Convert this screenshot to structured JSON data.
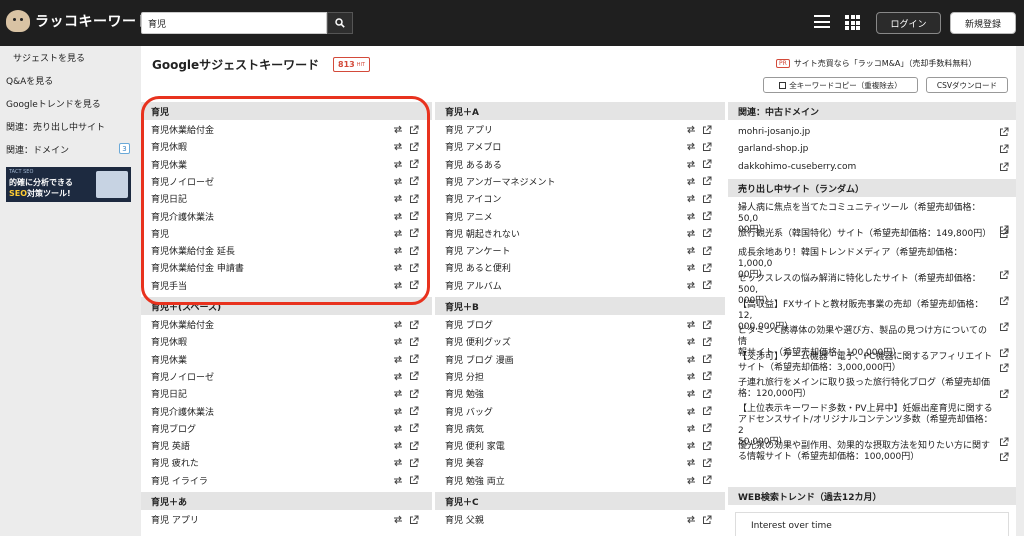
{
  "header": {
    "logo_text": "ラッコキーワード",
    "search_value": "育児",
    "login_label": "ログイン",
    "register_label": "新規登録"
  },
  "sidebar": {
    "items": [
      {
        "label": "サジェストを見る"
      },
      {
        "label": "Q&Aを見る"
      },
      {
        "label": "Googleトレンドを見る"
      },
      {
        "label": "関連：売り出し中サイト"
      },
      {
        "label": "関連：ドメイン",
        "badge": "3"
      }
    ],
    "banner": {
      "top": "TACT SEO",
      "line1": "的確に分析できる",
      "line2_a": "SEO",
      "line2_b": "対策ツール!"
    }
  },
  "main": {
    "title": "Googleサジェストキーワード",
    "hit_count": "813",
    "hit_unit": "HIT",
    "pr_badge": "PR",
    "pr_text": "サイト売買なら「ラッコM&A」（売却手数料無料）",
    "copy_label": "全キーワードコピー（重複除去）",
    "csv_label": "CSVダウンロード"
  },
  "columns": {
    "col1": [
      {
        "title": "育児",
        "items": [
          "育児休業給付金",
          "育児休暇",
          "育児休業",
          "育児ノイローゼ",
          "育児日記",
          "育児介護休業法",
          "育児",
          "育児休業給付金 延長",
          "育児休業給付金 申請書",
          "育児手当"
        ]
      },
      {
        "title": "育児＋(スペース)",
        "items": [
          "育児休業給付金",
          "育児休暇",
          "育児休業",
          "育児ノイローゼ",
          "育児日記",
          "育児介護休業法",
          "育児ブログ",
          "育児 英語",
          "育児 疲れた",
          "育児 イライラ"
        ]
      },
      {
        "title": "育児＋あ",
        "items": [
          "育児 アプリ"
        ]
      }
    ],
    "col2": [
      {
        "title": "育児＋A",
        "items": [
          "育児 アプリ",
          "育児 アメブロ",
          "育児 あるある",
          "育児 アンガーマネジメント",
          "育児 アイコン",
          "育児 アニメ",
          "育児 朝起きれない",
          "育児 アンケート",
          "育児 あると便利",
          "育児 アルバム"
        ]
      },
      {
        "title": "育児＋B",
        "items": [
          "育児 ブログ",
          "育児 便利グッズ",
          "育児 ブログ 漫画",
          "育児 分担",
          "育児 勉強",
          "育児 バッグ",
          "育児 病気",
          "育児 便利 家電",
          "育児 美容",
          "育児 勉強 両立"
        ]
      },
      {
        "title": "育児＋C",
        "items": [
          "育児 父親"
        ]
      }
    ],
    "col3": {
      "domains_title": "関連：中古ドメイン",
      "domains": [
        "mohri-josanjo.jp",
        "garland-shop.jp",
        "dakkohimo-cuseberry.com"
      ],
      "sites_title": "売り出し中サイト（ランダム）",
      "sites": [
        {
          "l1": "婦人病に焦点を当てたコミュニティツール（希望売却価格：50,0",
          "l2": "00円）"
        },
        {
          "l1": "旅行観光系（韓国特化）サイト（希望売却価格：149,800円）",
          "l2": ""
        },
        {
          "l1": "成長余地あり！韓国トレンドメディア（希望売却価格：1,000,0",
          "l2": "00円）"
        },
        {
          "l1": "セックスレスの悩み解消に特化したサイト（希望売却価格：500,",
          "l2": "000円）"
        },
        {
          "l1": "【高収益】FXサイトと教材販売事業の売却（希望売却価格：12,",
          "l2": "000,000円）"
        },
        {
          "l1": "ビタミンC誘導体の効果や選び方、製品の見つけ方についての情",
          "l2": "報サイト（希望売却価格：100,000円）"
        },
        {
          "l1": "【交渉可】ゲーム機器・電子、PC機器に関するアフィリエイト",
          "l2": "サイト（希望売却価格：3,000,000円）"
        },
        {
          "l1": "子連れ旅行をメインに取り扱った旅行特化ブログ（希望売却価",
          "l2": "格：120,000円）"
        },
        {
          "l1": "【上位表示キーワード多数・PV上昇中】妊娠出産育児に関する",
          "l2": "アドセンスサイト/オリジナルコンテンツ多数（希望売却価格：2",
          "l3": "50,000円）"
        },
        {
          "l1": "優光泉の効果や副作用、効果的な摂取方法を知りたい方に関す",
          "l2": "る情報サイト（希望売却価格：100,000円）"
        }
      ],
      "trend_title": "WEB検索トレンド（過去12カ月）",
      "trend_box_title": "Interest over time"
    }
  },
  "colors": {
    "header_bg": "#1f1f1f",
    "accent_red": "#e8321e",
    "section_bg": "#e4e4e4"
  },
  "icons": [
    "search-icon",
    "hamburger-icon",
    "grid-icon",
    "swap-icon",
    "external-link-icon",
    "copy-icon"
  ]
}
